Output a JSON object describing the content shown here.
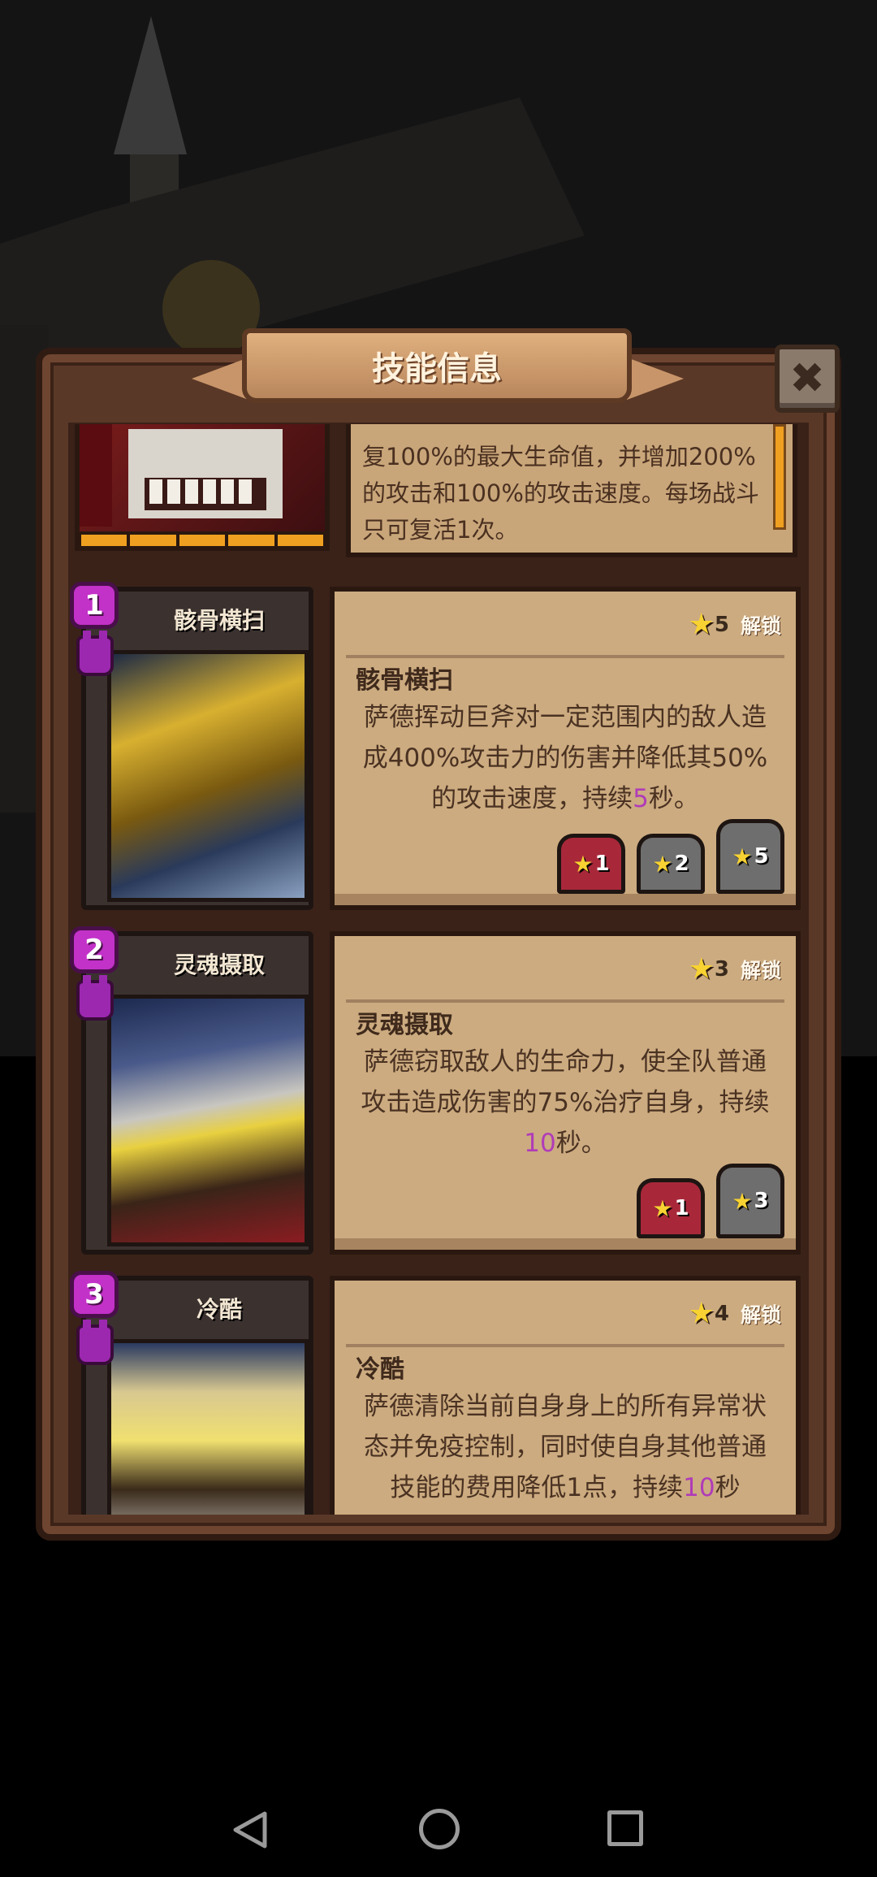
{
  "dialog": {
    "title": "技能信息",
    "close_symbol": "✖"
  },
  "previous_skill": {
    "description_partial": "复100%的最大生命值，并增加200%的攻击和100%的攻击速度。每场战斗只可复活1次。",
    "energy_segments": 5
  },
  "skills": [
    {
      "number": "1",
      "name": "骸骨横扫",
      "star_cost": "5",
      "unlock_label": "解锁",
      "title": "骸骨横扫",
      "desc_before": "萨德挥动巨斧对一定范围内的敌人造成400%攻击力的伤害并降低其50%的攻击速度，持续",
      "desc_highlight": "5",
      "desc_after": "秒。",
      "levels": [
        "1",
        "2",
        "5"
      ]
    },
    {
      "number": "2",
      "name": "灵魂摄取",
      "star_cost": "3",
      "unlock_label": "解锁",
      "title": "灵魂摄取",
      "desc_before": "萨德窃取敌人的生命力，使全队普通攻击造成伤害的75%治疗自身，持续",
      "desc_highlight": "10",
      "desc_after": "秒。",
      "levels": [
        "1",
        "3"
      ]
    },
    {
      "number": "3",
      "name": "冷酷",
      "star_cost": "4",
      "unlock_label": "解锁",
      "title": "冷酷",
      "desc_before": "萨德清除当前自身身上的所有异常状态并免疫控制，同时使自身其他普通技能的费用降低1点，持续",
      "desc_highlight": "10",
      "desc_after": "秒",
      "levels": []
    }
  ],
  "icons": {
    "star": "★",
    "demon": "demon-icon",
    "back": "nav-back-icon",
    "home": "nav-home-icon",
    "recent": "nav-recent-icon"
  },
  "colors": {
    "highlight": "#b03cb8",
    "badge": "#c231c8",
    "star": "#f7d232"
  }
}
